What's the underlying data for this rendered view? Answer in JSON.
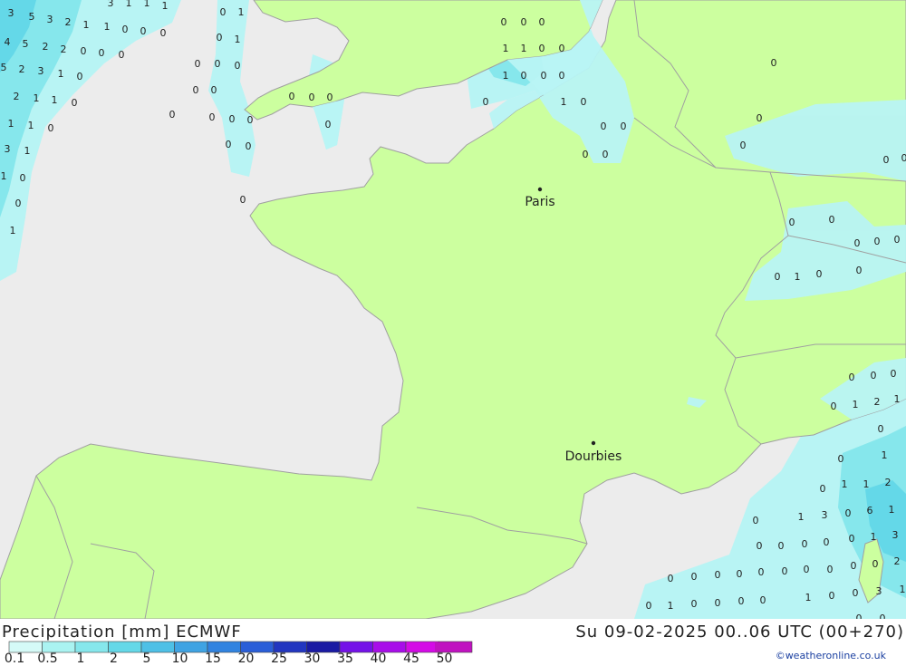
{
  "map": {
    "colors": {
      "sea": "#ececec",
      "land": "#ccff9f",
      "border": "#a0a0a0",
      "label": "#222222"
    },
    "cities": [
      {
        "name": "Paris"
      },
      {
        "name": "Dourbies"
      }
    ]
  },
  "footer": {
    "title": "Precipitation [mm] ECMWF",
    "datetime": "Su 09-02-2025 00..06 UTC (00+270)",
    "credit": "©weatheronline.co.uk"
  },
  "legend": {
    "labels": [
      "0.1",
      "0.5",
      "1",
      "2",
      "5",
      "10",
      "15",
      "20",
      "25",
      "30",
      "35",
      "40",
      "45",
      "50"
    ],
    "colors": [
      "#d5faf7",
      "#aaf3f1",
      "#86e7ec",
      "#64d8e8",
      "#4ec0e6",
      "#3fa3e3",
      "#3183e0",
      "#2a5ed8",
      "#2236c0",
      "#1a1aa3",
      "#7412e8",
      "#a80de9",
      "#d40be6",
      "#c012c0"
    ]
  }
}
